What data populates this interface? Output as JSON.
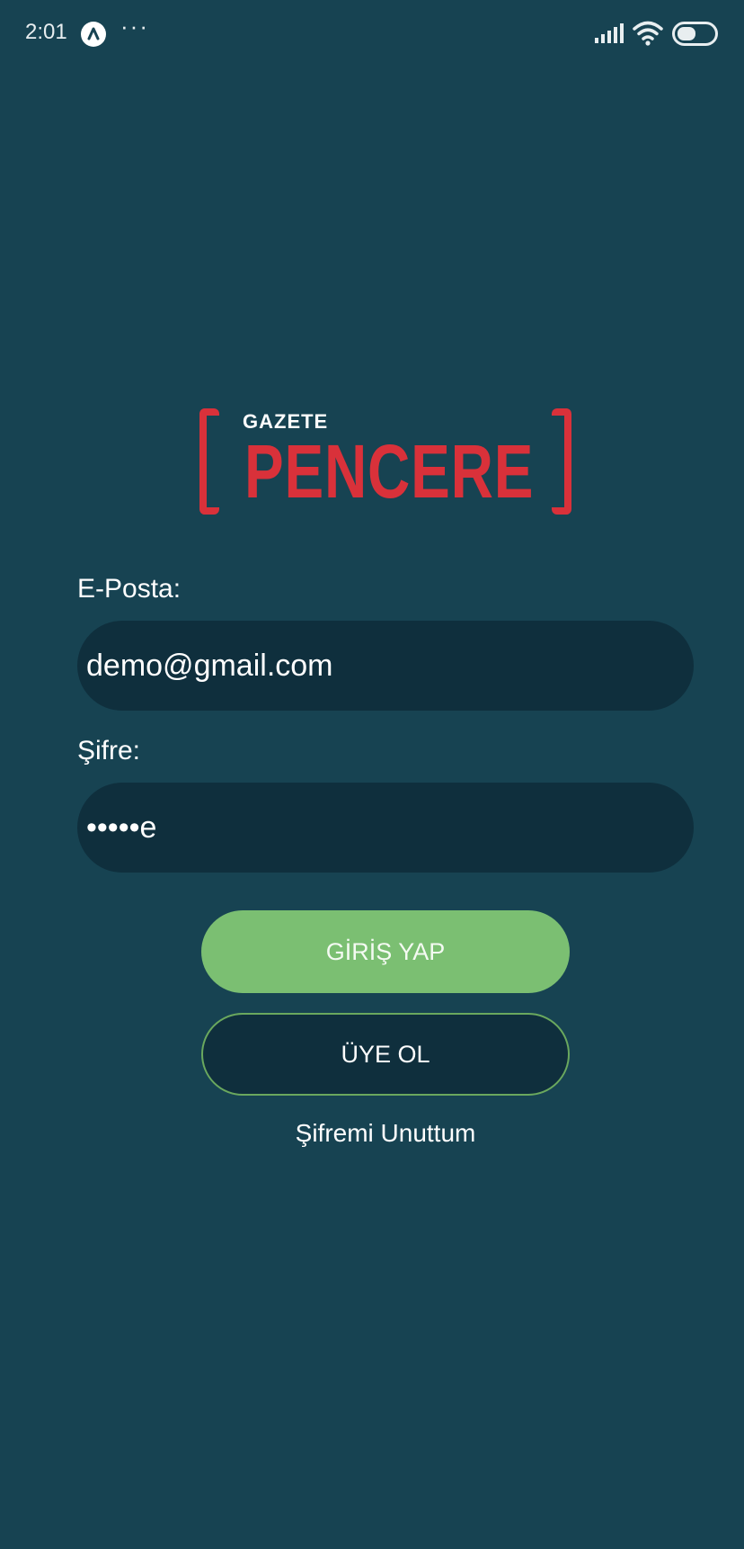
{
  "status_bar": {
    "time": "2:01",
    "more": "···",
    "icons": [
      "app-notification-icon",
      "signal-icon",
      "wifi-icon",
      "battery-icon"
    ]
  },
  "logo": {
    "small_text": "GAZETE",
    "big_text": "PENCERE",
    "color": "#d9313a"
  },
  "form": {
    "email_label": "E-Posta:",
    "email_value": "demo@gmail.com",
    "password_label": "Şifre:",
    "password_value": "•••••e"
  },
  "actions": {
    "login_label": "GİRİŞ YAP",
    "register_label": "ÜYE OL",
    "forgot_label": "Şifremi Unuttum"
  },
  "colors": {
    "background": "#174352",
    "input_background": "#0f2f3d",
    "login_button": "#7bbf72",
    "register_border": "#6aa85e"
  }
}
